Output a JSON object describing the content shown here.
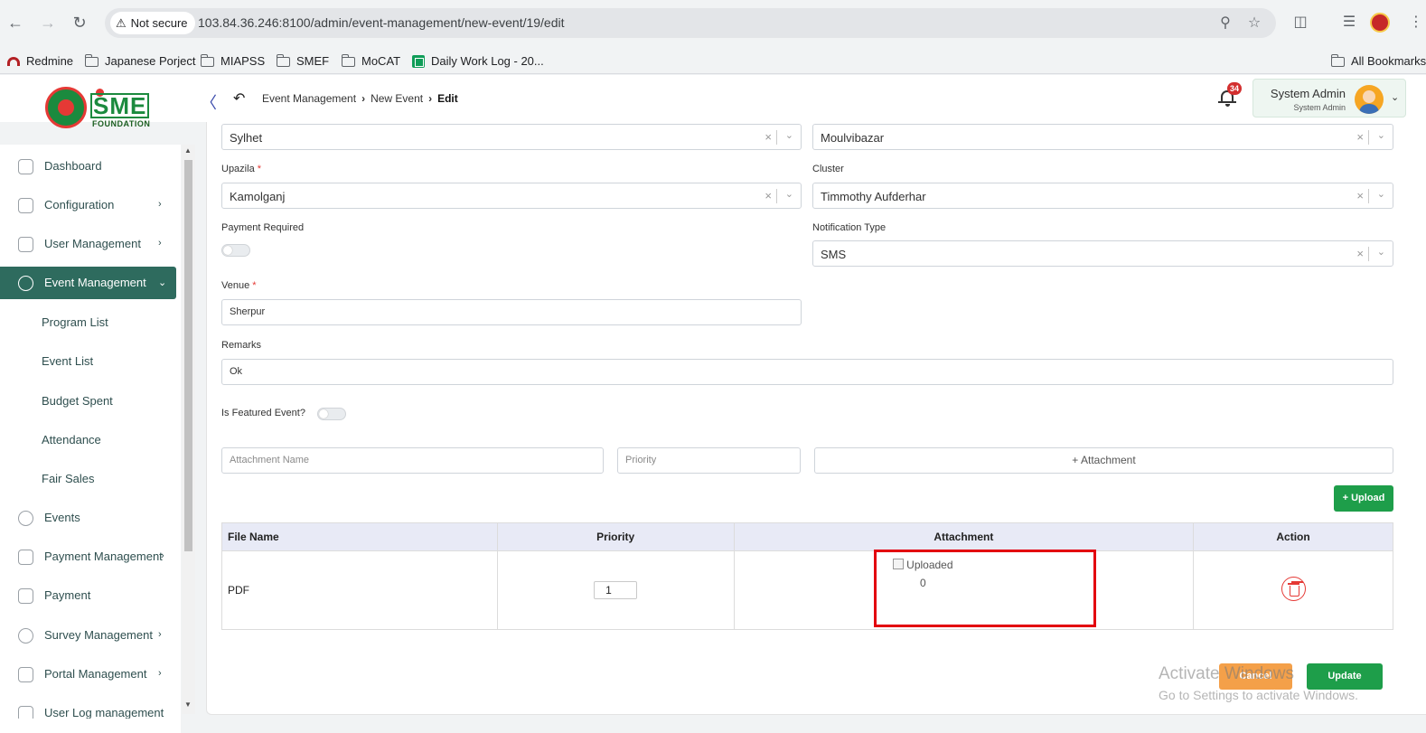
{
  "browser": {
    "security_label": "Not secure",
    "url": "103.84.36.246:8100/admin/event-management/new-event/19/edit",
    "bookmarks": [
      "Redmine",
      "Japanese Porject",
      "MIAPSS",
      "SMEF",
      "MoCAT",
      "Daily Work Log - 20..."
    ],
    "all_bookmarks": "All Bookmarks"
  },
  "header": {
    "logo_text": "SME",
    "logo_subtext": "FOUNDATION",
    "breadcrumb": [
      "Event Management",
      "New Event",
      "Edit"
    ],
    "notification_count": "34",
    "user_name": "System Admin",
    "user_role": "System Admin"
  },
  "sidebar": {
    "items": [
      {
        "label": "Dashboard",
        "icon": "grid-icon"
      },
      {
        "label": "Configuration",
        "icon": "config-icon"
      },
      {
        "label": "User Management",
        "icon": "shield-icon"
      },
      {
        "label": "Event Management",
        "icon": "event-icon"
      },
      {
        "label": "Events",
        "icon": "events-icon"
      },
      {
        "label": "Payment Management",
        "icon": "payment-management-icon"
      },
      {
        "label": "Payment",
        "icon": "payment-icon"
      },
      {
        "label": "Survey Management",
        "icon": "survey-icon"
      },
      {
        "label": "Portal Management",
        "icon": "portal-icon"
      },
      {
        "label": "User Log management",
        "icon": "log-icon"
      }
    ],
    "subitems": [
      "Program List",
      "Event List",
      "Budget Spent",
      "Attendance",
      "Fair Sales"
    ]
  },
  "form": {
    "district_value": "Sylhet",
    "subdistrict_value": "Moulvibazar",
    "upazila_label": "Upazila",
    "upazila_value": "Kamolganj",
    "cluster_label": "Cluster",
    "cluster_value": "Timmothy Aufderhar",
    "payment_required_label": "Payment Required",
    "notification_type_label": "Notification Type",
    "notification_type_value": "SMS",
    "venue_label": "Venue",
    "venue_value": "Sherpur",
    "remarks_label": "Remarks",
    "remarks_value": "Ok",
    "featured_label": "Is Featured Event?",
    "attachment_name_placeholder": "Attachment Name",
    "priority_placeholder": "Priority",
    "attachment_button": "+ Attachment",
    "upload_button": "Upload",
    "required_mark": "*"
  },
  "table": {
    "headers": [
      "File Name",
      "Priority",
      "Attachment",
      "Action"
    ],
    "rows": [
      {
        "file_name": "PDF",
        "priority": "1",
        "attachment_alt": "Uploaded",
        "attachment_count": "0"
      }
    ]
  },
  "actions": {
    "cancel": "Cancel",
    "update": "Update"
  },
  "watermark": {
    "line1": "Activate Windows",
    "line2": "Go to Settings to activate Windows."
  }
}
